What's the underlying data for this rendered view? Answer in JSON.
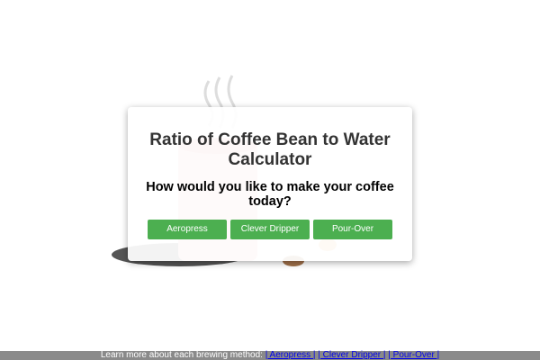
{
  "card": {
    "title": "Ratio of Coffee Bean to Water Calculator",
    "question": "How would you like to make your coffee today?"
  },
  "methods": [
    {
      "label": "Aeropress"
    },
    {
      "label": "Clever Dripper"
    },
    {
      "label": "Pour-Over"
    }
  ],
  "footer": {
    "intro": "Learn more about each brewing method:",
    "links": [
      {
        "label": "| Aeropress |"
      },
      {
        "label": "| Clever Dripper |"
      },
      {
        "label": "| Pour-Over |"
      }
    ]
  },
  "colors": {
    "button": "#4caf50",
    "footer_bg": "#8a8a8a",
    "link": "#0000ee",
    "mug": "#e8a0a0"
  }
}
